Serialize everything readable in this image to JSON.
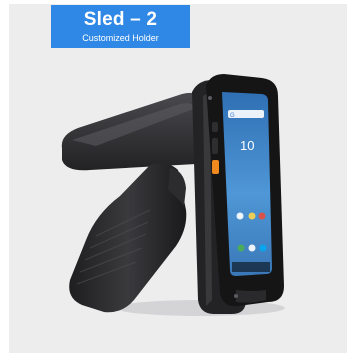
{
  "badge": {
    "title": "Sled – 2",
    "subtitle": "Customized Holder",
    "color": "#2f88e6"
  },
  "phone_screen": {
    "time": "10"
  },
  "image": {
    "subject": "rfid-sled-pistol-grip-with-phone",
    "background_color": "#ededee"
  }
}
